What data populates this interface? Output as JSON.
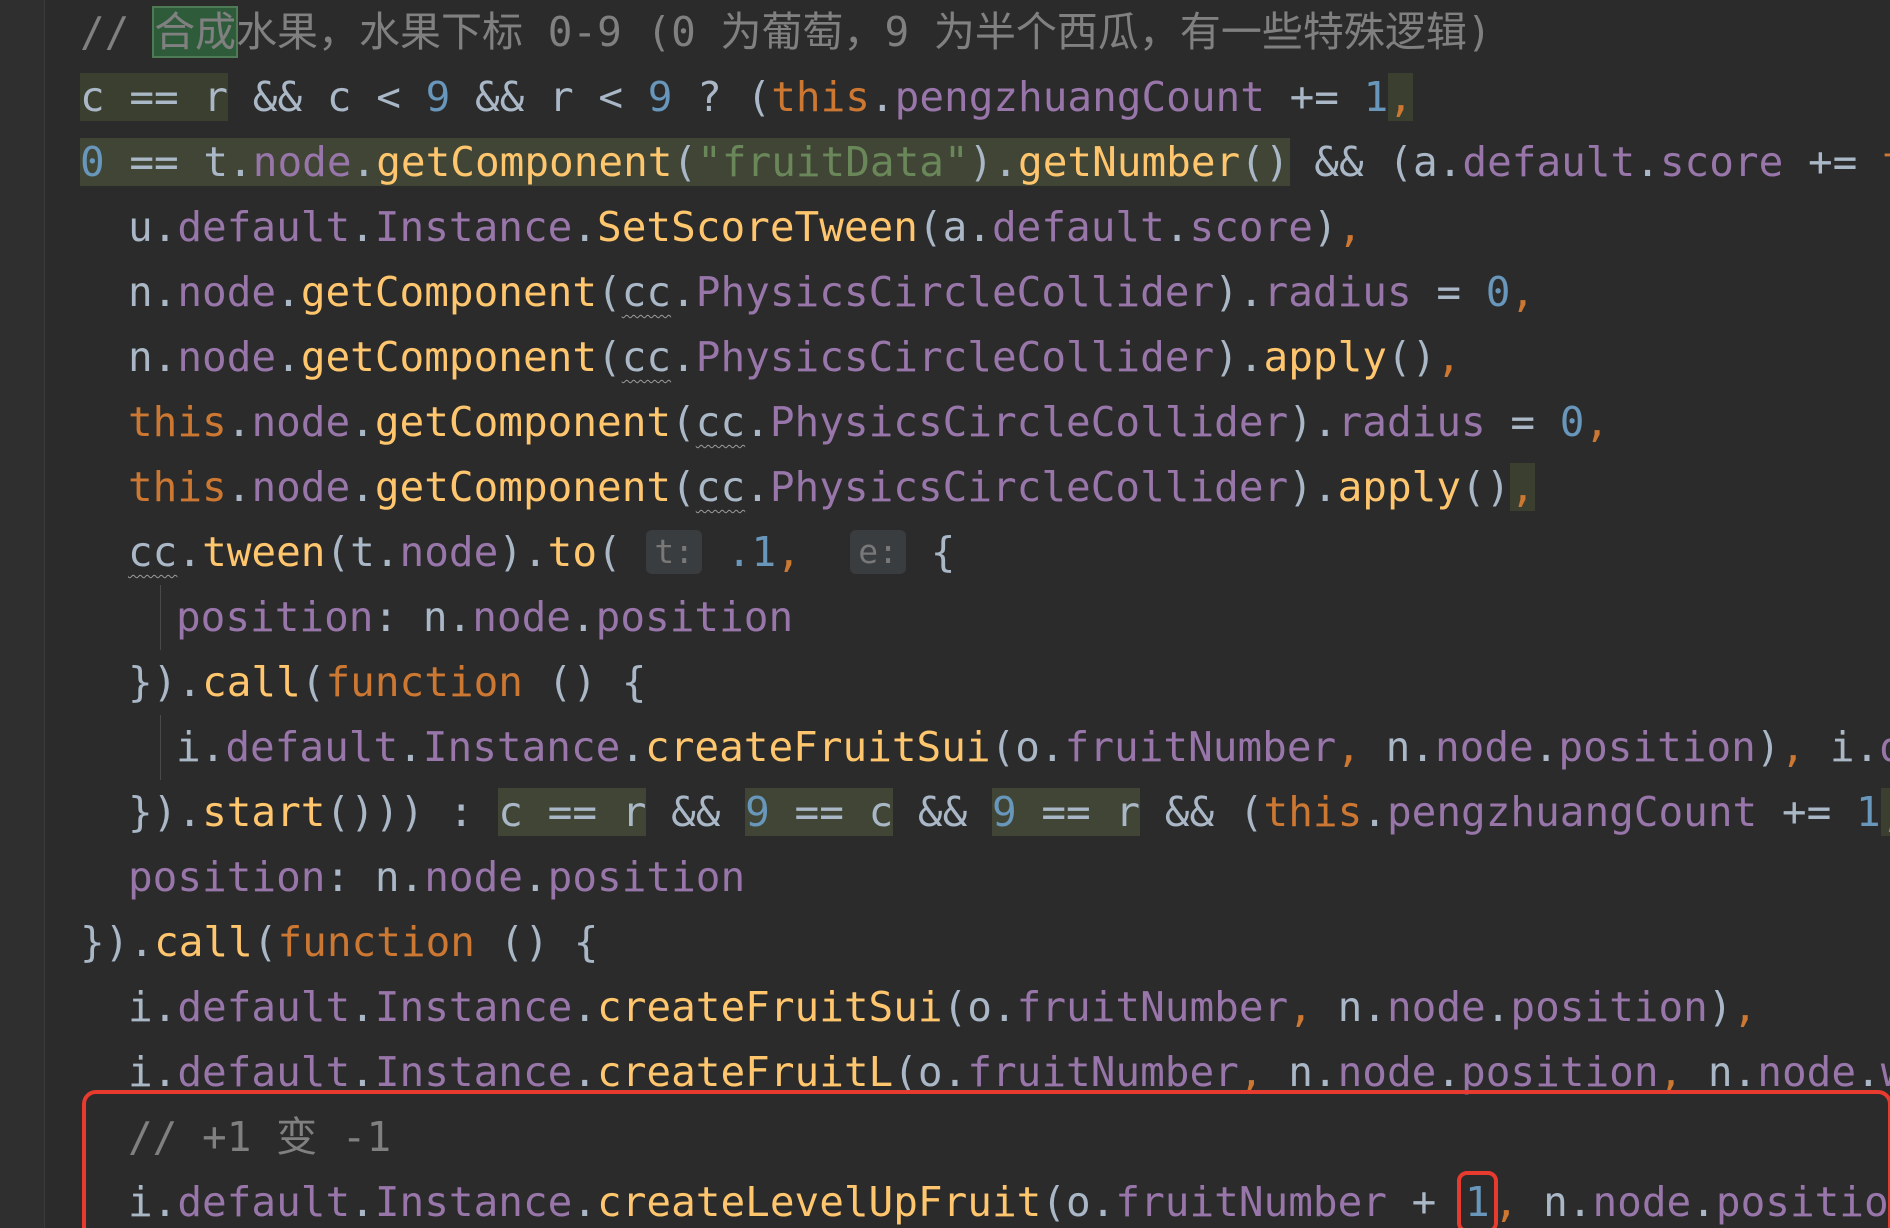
{
  "comment_line": {
    "prefix": "// ",
    "selected": "合成",
    "rest": "水果，水果下标 0-9 (0 为葡萄，9 为半个西瓜，有一些特殊逻辑)"
  },
  "tokens": {
    "this": "this",
    "function": "function",
    "pengzhuangCount": "pengzhuangCount",
    "default": "default",
    "score": "score",
    "Instance": "Instance",
    "node": "node",
    "position": "position",
    "fruitNumber": "fruitNumber",
    "getComponent": "getComponent",
    "PhysicsCircleCollider": "PhysicsCircleCollider",
    "radius": "radius",
    "apply": "apply",
    "cc": "cc",
    "tween": "tween",
    "to": "to",
    "call": "call",
    "start": "start",
    "fruitData_str": "\"fruitData\"",
    "getNumber": "getNumber",
    "SetScoreTween": "SetScoreTween",
    "createFruitSui": "createFruitSui",
    "createFruitL": "createFruitL",
    "createLevelUpFruit": "createLevelUpFruit",
    "defa_trunc": "defa",
    "widt_trunc": "widt",
    "hint_t": "t:",
    "hint_e": "e:",
    "num_0": "0",
    "num_1": "1",
    "num_9": "9",
    "num_p1": ".1"
  },
  "bottom_comment": "// +1 变 -1",
  "highlight_box_value": "1"
}
